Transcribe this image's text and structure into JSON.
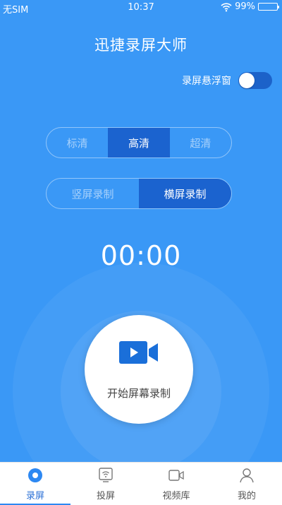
{
  "status_bar": {
    "carrier": "无SIM",
    "time": "10:37",
    "battery": "99%"
  },
  "app_title": "迅捷录屏大师",
  "floating_window": {
    "label": "录屏悬浮窗",
    "enabled": true
  },
  "quality": {
    "options": [
      "标清",
      "高清",
      "超清"
    ],
    "selected": "高清"
  },
  "orientation": {
    "options": [
      "竖屏录制",
      "横屏录制"
    ],
    "selected": "横屏录制"
  },
  "timer": "00:00",
  "record_button": {
    "label": "开始屏幕录制",
    "icon": "video-camera-icon"
  },
  "tabs": [
    {
      "label": "录屏",
      "icon": "record-icon",
      "active": true
    },
    {
      "label": "投屏",
      "icon": "screen-cast-icon",
      "active": false
    },
    {
      "label": "视频库",
      "icon": "video-library-icon",
      "active": false
    },
    {
      "label": "我的",
      "icon": "profile-icon",
      "active": false
    }
  ],
  "colors": {
    "background": "#3a98f6",
    "active_segment": "#1b63cf",
    "tab_active": "#2a6fd6"
  }
}
